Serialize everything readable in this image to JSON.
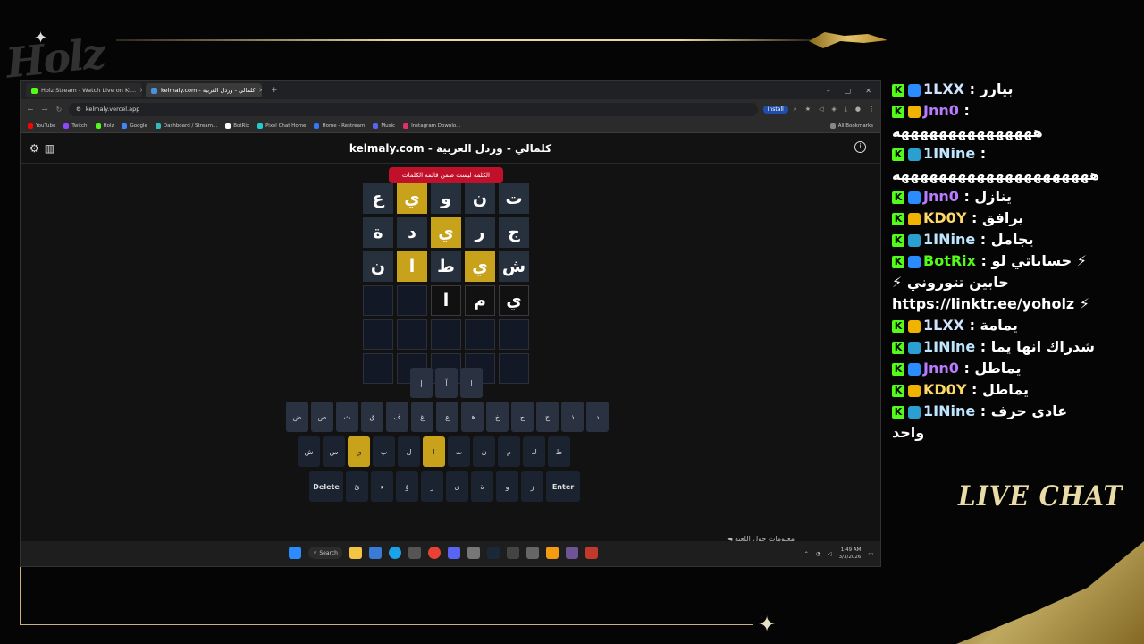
{
  "overlay": {
    "logo_text": "Holz",
    "live_chat_label": "LIVE CHAT",
    "accent": "#e0c670"
  },
  "browser": {
    "tabs": [
      {
        "label": "Holz Stream - Watch Live on Ki...",
        "active": false
      },
      {
        "label": "kelmaly.com - كلمالي - وردل العربية",
        "active": true
      }
    ],
    "new_tab": "+",
    "window_controls": [
      "–",
      "▢",
      "✕"
    ],
    "url": "kelmaly.vercel.app",
    "install_label": "Install",
    "bookmarks": [
      "YouTube",
      "Twitch",
      "Holz",
      "Google",
      "Dashboard / Stream...",
      "BotRix",
      "Pixel Chat Home",
      "Home - Restream",
      "Music",
      "Instagram Downlo..."
    ],
    "all_bookmarks": "All Bookmarks"
  },
  "game": {
    "title": "kelmaly.com - كلمالي - وردل العربية",
    "toast": "الكلمة ليست ضمن قائمة الكلمات",
    "rows": [
      [
        {
          "l": "ت",
          "s": "absent"
        },
        {
          "l": "ن",
          "s": "absent"
        },
        {
          "l": "و",
          "s": "absent"
        },
        {
          "l": "ي",
          "s": "present"
        },
        {
          "l": "ع",
          "s": "absent"
        }
      ],
      [
        {
          "l": "ج",
          "s": "absent"
        },
        {
          "l": "ر",
          "s": "absent"
        },
        {
          "l": "ي",
          "s": "present"
        },
        {
          "l": "د",
          "s": "absent"
        },
        {
          "l": "ة",
          "s": "absent"
        }
      ],
      [
        {
          "l": "ش",
          "s": "absent"
        },
        {
          "l": "ي",
          "s": "present"
        },
        {
          "l": "ط",
          "s": "absent"
        },
        {
          "l": "ا",
          "s": "present"
        },
        {
          "l": "ن",
          "s": "absent"
        }
      ],
      [
        {
          "l": "ي",
          "s": "typed"
        },
        {
          "l": "م",
          "s": "typed"
        },
        {
          "l": "ا",
          "s": "typed"
        },
        {
          "l": "",
          "s": "empty"
        },
        {
          "l": "",
          "s": "empty"
        }
      ],
      [
        {
          "l": "",
          "s": "empty"
        },
        {
          "l": "",
          "s": "empty"
        },
        {
          "l": "",
          "s": "empty"
        },
        {
          "l": "",
          "s": "empty"
        },
        {
          "l": "",
          "s": "empty"
        }
      ],
      [
        {
          "l": "",
          "s": "empty"
        },
        {
          "l": "",
          "s": "empty"
        },
        {
          "l": "",
          "s": "empty"
        },
        {
          "l": "",
          "s": "empty"
        },
        {
          "l": "",
          "s": "empty"
        }
      ]
    ],
    "keyboard": {
      "row0": [
        "ا",
        "آ",
        "إ"
      ],
      "row1": [
        "د",
        "ذ",
        "ج",
        "ح",
        "خ",
        "هـ",
        "ع",
        "غ",
        "ف",
        "ق",
        "ث",
        "ص",
        "ض"
      ],
      "row2": [
        "ط",
        "ك",
        "م",
        "ن",
        "ت",
        "ا",
        "ل",
        "ب",
        "ي",
        "س",
        "ش"
      ],
      "row3": [
        "Enter",
        "ز",
        "و",
        "ة",
        "ى",
        "ر",
        "ؤ",
        "ء",
        "ئ",
        "Delete"
      ],
      "present_keys": [
        "ي",
        "ا"
      ]
    },
    "footer": "◄ معلومات حول اللعبة"
  },
  "taskbar": {
    "search_label": "Search",
    "time": "1:49 AM",
    "date": "3/3/2026"
  },
  "chat": {
    "messages": [
      {
        "user": "1LXX",
        "text": "بيارر",
        "color": "#cfe3ff"
      },
      {
        "user": "Jnn0",
        "text": "",
        "cont": "هههههههههههههههه",
        "color": "#b77cff"
      },
      {
        "user": "1INine",
        "text": "",
        "cont": "هههههههههههههههههههههه",
        "color": "#bfe6ff"
      },
      {
        "user": "Jnn0",
        "text": "ينازل",
        "color": "#b77cff"
      },
      {
        "user": "KD0Y",
        "text": "يرافق",
        "color": "#ffd86a"
      },
      {
        "user": "1INine",
        "text": "يجامل",
        "color": "#bfe6ff"
      },
      {
        "user": "BotRix",
        "text": "حساباتي لو ⚡",
        "cont": "⚡ حابين تتوروني",
        "cont2": "https://linktr.ee/yoholz ⚡",
        "color": "#53fc18"
      },
      {
        "user": "1LXX",
        "text": "يمامة",
        "color": "#cfe3ff"
      },
      {
        "user": "1INine",
        "text": "شدراك انها يما",
        "color": "#bfe6ff"
      },
      {
        "user": "Jnn0",
        "text": "يماطل",
        "color": "#b77cff"
      },
      {
        "user": "KD0Y",
        "text": "يماطل",
        "color": "#ffd86a"
      },
      {
        "user": "1INine",
        "text": "عادي حرف",
        "cont": "واحد",
        "color": "#bfe6ff"
      }
    ]
  }
}
